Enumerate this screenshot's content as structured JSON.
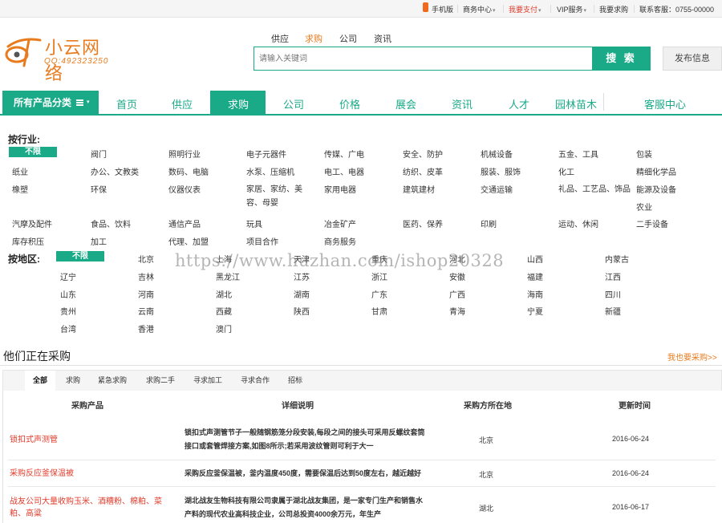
{
  "topbar": {
    "mobile": "手机版",
    "biz_center": "商务中心",
    "pay": "我要支付",
    "vip": "VIP服务",
    "buy": "我要求购",
    "contact": "联系客服：0755-00000"
  },
  "logo": {
    "name": "小云网络",
    "qq": "QQ:492323250"
  },
  "search": {
    "tabs": [
      "供应",
      "求购",
      "公司",
      "资讯"
    ],
    "placeholder": "请输入关键词",
    "button": "搜 索",
    "publish": "发布信息"
  },
  "nav": {
    "all_categories": "所有产品分类",
    "items": [
      "首页",
      "供应",
      "求购",
      "公司",
      "价格",
      "展会",
      "资讯",
      "人才",
      "园林苗木",
      "客服中心"
    ],
    "active": "求购"
  },
  "filter": {
    "industry_label": "按行业:",
    "region_label": "按地区:",
    "unlimited": "不限",
    "industries": [
      "阀门",
      "照明行业",
      "电子元器件",
      "传媒、广电",
      "安全、防护",
      "机械设备",
      "五金、工具",
      "包装",
      "纸业",
      "办公、文教类",
      "数码、电脑",
      "水泵、压缩机",
      "电工、电器",
      "纺织、皮革",
      "服装、服饰",
      "化工",
      "精细化学品",
      "橡塑",
      "环保",
      "仪器仪表",
      "家居、家纺、美容、母婴",
      "家用电器",
      "建筑建材",
      "交通运输",
      "礼品、工艺品、饰品",
      "能源及设备",
      "农业",
      "汽摩及配件",
      "食品、饮料",
      "通信产品",
      "玩具",
      "冶金矿产",
      "医药、保养",
      "印刷",
      "运动、休闲",
      "二手设备",
      "库存积压",
      "加工",
      "代理、加盟",
      "项目合作",
      "商务服务"
    ],
    "regions": [
      "北京",
      "上海",
      "天津",
      "重庆",
      "河北",
      "山西",
      "内蒙古",
      "辽宁",
      "吉林",
      "黑龙江",
      "江苏",
      "浙江",
      "安徽",
      "福建",
      "江西",
      "山东",
      "河南",
      "湖北",
      "湖南",
      "广东",
      "广西",
      "海南",
      "四川",
      "贵州",
      "云南",
      "西藏",
      "陕西",
      "甘肃",
      "青海",
      "宁夏",
      "新疆",
      "台湾",
      "香港",
      "澳门"
    ]
  },
  "watermark": "https://www.huzhan.com/ishop20328",
  "purchase": {
    "title": "他们正在采购",
    "more": "我也要采购>>",
    "tabs": [
      "全部",
      "求购",
      "紧急求购",
      "求购二手",
      "寻求加工",
      "寻求合作",
      "招标"
    ],
    "headers": [
      "采购产品",
      "详细说明",
      "采购方所在地",
      "更新时间"
    ],
    "rows": [
      {
        "name": "锁扣式声测管",
        "desc": "锁扣式声测管节子一般随钢筋笼分段安装,每段之间的接头可采用反螺纹套筒接口或套管焊接方案,如图8所示;若采用波纹管则可利于大一",
        "loc": "北京",
        "date": "2016-06-24"
      },
      {
        "name": "采购反应釜保温被",
        "desc": "采购反应釜保温被，釜内温度450度，需要保温后达到50度左右，越近越好",
        "loc": "北京",
        "date": "2016-06-24"
      },
      {
        "name": "战友公司大量收购玉米、酒糟粉、棉粕、菜粕、高粱",
        "desc": "湖北战友生物科技有限公司隶属于湖北战友集团，是一家专门生产和销售水产料的现代农业高科技企业，公司总投资4000余万元，年生产",
        "loc": "湖北",
        "date": "2016-06-17"
      }
    ]
  },
  "colors": {
    "accent": "#1aaa88",
    "orange": "#e87b1e",
    "red": "#e03c2c"
  }
}
